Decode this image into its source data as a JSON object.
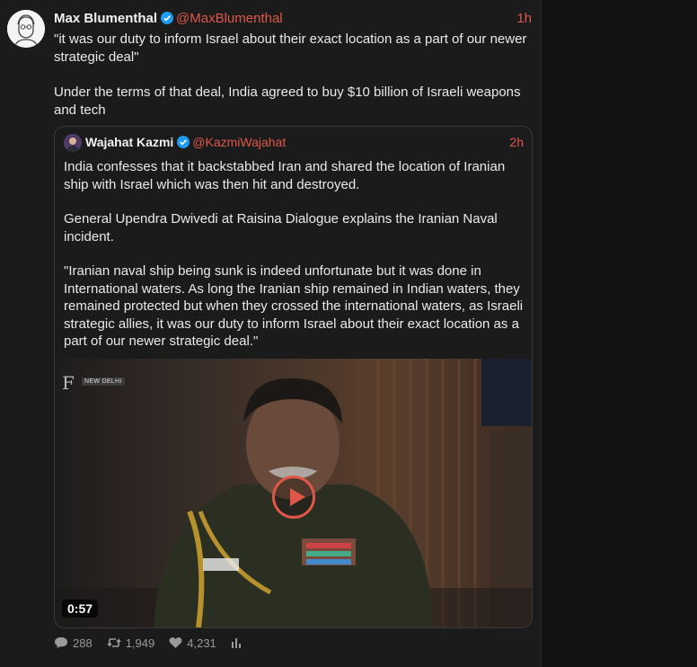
{
  "tweet": {
    "author_name": "Max Blumenthal",
    "author_handle": "@MaxBlumenthal",
    "time": "1h",
    "paragraphs": [
      "\"it was our duty to inform Israel about their exact location as a part of our newer strategic deal\"",
      "Under the terms of that deal, India agreed to buy $10 billion of Israeli weapons and tech"
    ],
    "stats": {
      "replies": "288",
      "retweets": "1,949",
      "likes": "4,231"
    }
  },
  "quoted": {
    "author_name": "Wajahat Kazmi",
    "author_handle": "@KazmiWajahat",
    "time": "2h",
    "paragraphs": [
      "India confesses that it backstabbed Iran and shared the location of Iranian ship with Israel which was then hit and destroyed.",
      "General Upendra Dwivedi at Raisina Dialogue explains the Iranian Naval incident.",
      "\"Iranian naval ship being sunk is indeed unfortunate but it was done in International waters. As long the Iranian ship remained in Indian waters, they remained protected but when they crossed the international waters, as Israeli strategic allies, it was our duty to inform Israel about their exact location as a part of our newer strategic deal.\""
    ],
    "video": {
      "duration": "0:57",
      "overlay_tag": "NEW DELHI",
      "logo": "F"
    }
  },
  "colors": {
    "accent": "#e0574a",
    "verified": "#1d9bf0",
    "background": "#1b1b1c"
  }
}
